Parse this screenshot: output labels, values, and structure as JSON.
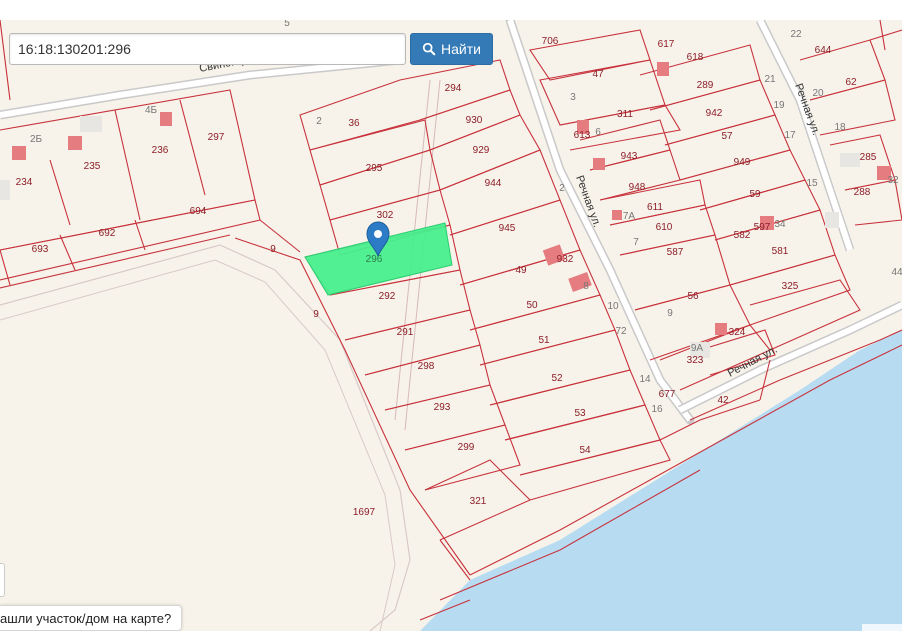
{
  "search": {
    "value": "16:18:130201:296",
    "button_label": "Найти"
  },
  "feedback": {
    "text": "ашли участок/дом на карте?"
  },
  "map": {
    "colors": {
      "land": "#f7f3ea",
      "water": "#b7dcf2",
      "parcel_line": "#c8323c",
      "label": "#8c1e28",
      "building": "#e57c80",
      "house_number": "#777777",
      "highlight": "#47ef8e",
      "marker": "#2c7bc6"
    },
    "streets": [
      {
        "name": "Свиногорская"
      },
      {
        "name": "Речная ул."
      },
      {
        "name": "Речная ул."
      },
      {
        "name": "Речная ул."
      }
    ],
    "parcels": [
      "706",
      "617",
      "618",
      "47",
      "289",
      "311",
      "942",
      "943",
      "57",
      "949",
      "948",
      "611",
      "610",
      "59",
      "587",
      "582",
      "597",
      "581",
      "56",
      "325",
      "324",
      "323",
      "42",
      "294",
      "36",
      "930",
      "929",
      "944",
      "295",
      "302",
      "945",
      "296",
      "49",
      "932",
      "292",
      "50",
      "291",
      "51",
      "298",
      "52",
      "293",
      "53",
      "299",
      "54",
      "321",
      "1697",
      "9",
      "9",
      "694",
      "693",
      "692",
      "234",
      "235",
      "236",
      "297",
      "644",
      "62",
      "285",
      "288",
      "677",
      "613"
    ],
    "house_numbers": [
      "5",
      "22",
      "20",
      "18",
      "4Б",
      "2Б",
      "2",
      "3",
      "21",
      "19",
      "17",
      "15",
      "8",
      "10",
      "72",
      "7",
      "7А",
      "9",
      "9А",
      "14",
      "16",
      "6",
      "2",
      "34",
      "32",
      "44"
    ],
    "selected_parcel": "296"
  }
}
